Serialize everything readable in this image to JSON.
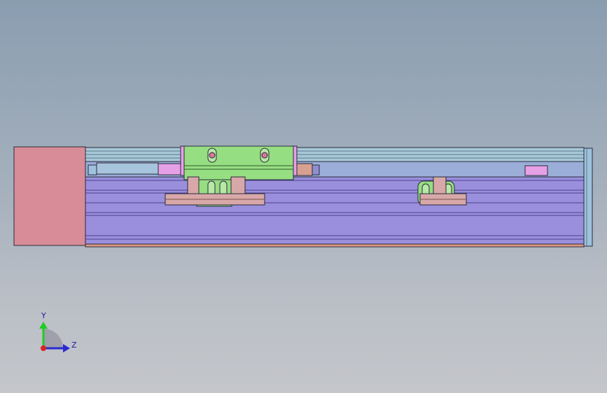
{
  "triad": {
    "y_label": "Y",
    "z_label": "Z",
    "colors": {
      "y_axis": "#22cc22",
      "z_axis": "#2a2ad0",
      "x_axis": "#dd2222"
    }
  },
  "colors": {
    "motor": "#d88c98",
    "rail_base": "#9a8fdc",
    "rail_top": "#a8c8d8",
    "carriage": "#96de82",
    "magenta_parts": "#e6a0e6",
    "bracket": "#d8a8a8",
    "endcap": "#9fc2dc",
    "bottom_strip": "#e09a80"
  }
}
